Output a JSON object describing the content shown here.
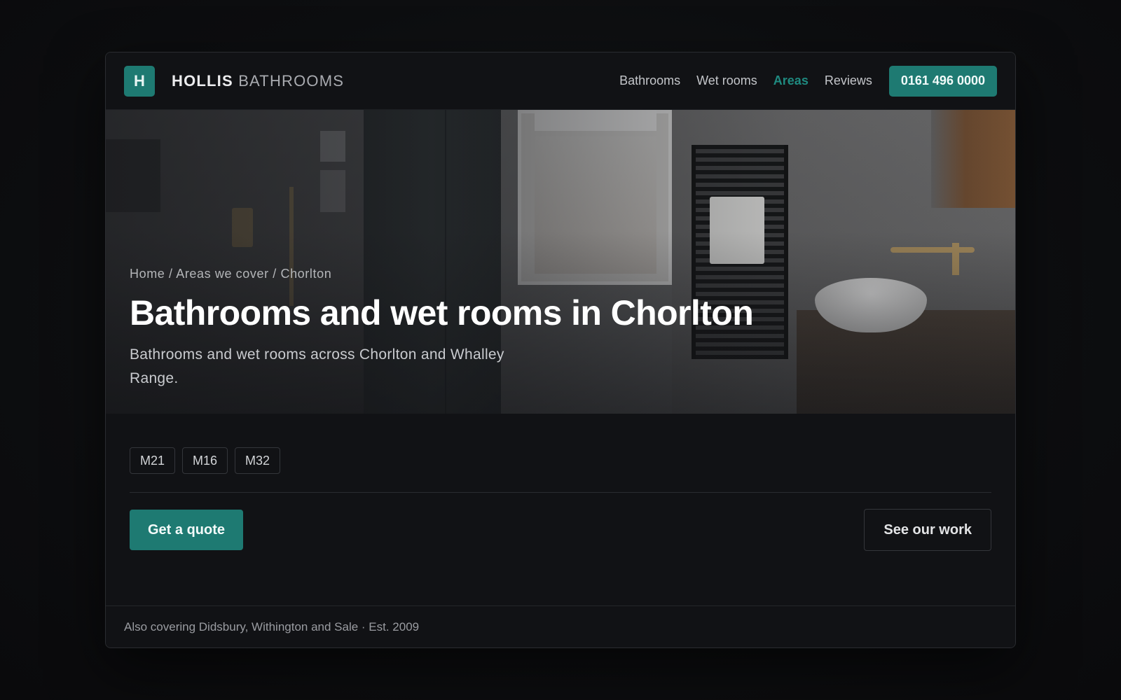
{
  "header": {
    "logo_letter": "H",
    "brand_primary": "HOLLIS",
    "brand_secondary": "BATHROOMS",
    "nav": [
      {
        "label": "Bathrooms",
        "active": false
      },
      {
        "label": "Wet rooms",
        "active": false
      },
      {
        "label": "Areas",
        "active": true
      },
      {
        "label": "Reviews",
        "active": false
      }
    ],
    "phone": "0161 496 0000"
  },
  "hero": {
    "breadcrumb": "Home / Areas we cover / Chorlton",
    "title": "Bathrooms and wet rooms in Chorlton",
    "subtitle": "Bathrooms and wet rooms across Chorlton and Whalley Range.",
    "image": "bathroom-photo"
  },
  "postcodes": [
    "M21",
    "M16",
    "M32"
  ],
  "actions": {
    "primary": "Get a quote",
    "secondary": "See our work"
  },
  "footer": {
    "text": "Also covering Didsbury, Withington and Sale · Est. 2009"
  },
  "colors": {
    "accent": "#1e7a72",
    "accent_text": "#1f8a80",
    "background": "#111215"
  }
}
